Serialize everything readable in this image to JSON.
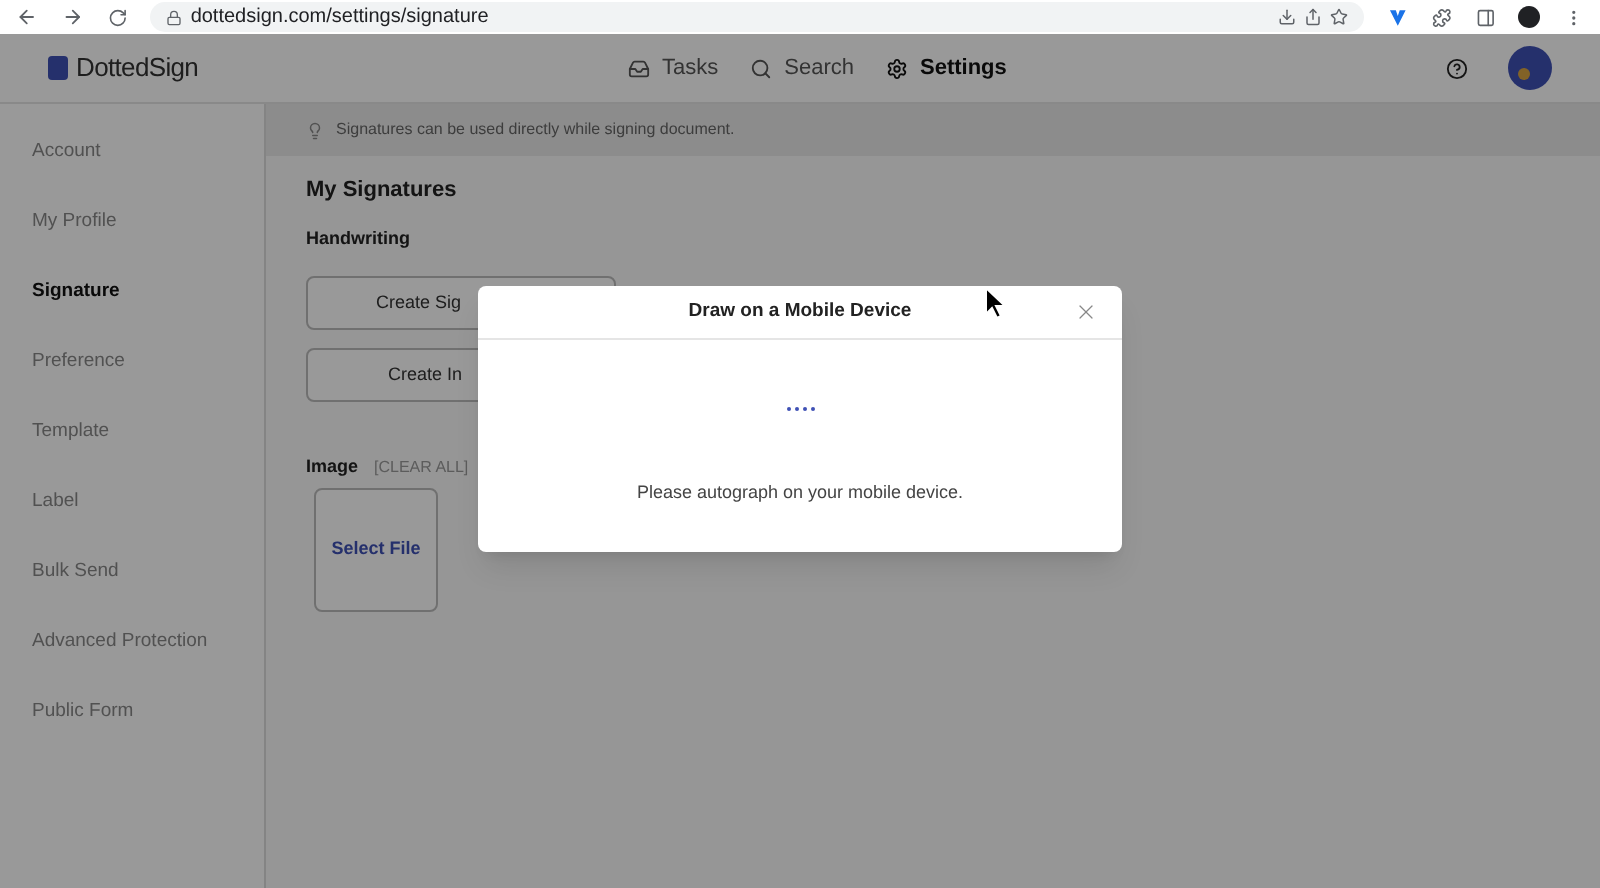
{
  "browser": {
    "url": "dottedsign.com/settings/signature"
  },
  "header": {
    "logo": "DottedSign",
    "nav": [
      {
        "label": "Tasks",
        "kind": "tasks",
        "selected": false
      },
      {
        "label": "Search",
        "kind": "search",
        "selected": false
      },
      {
        "label": "Settings",
        "kind": "settings",
        "selected": true
      }
    ]
  },
  "sidebar": {
    "items": [
      {
        "label": "Account",
        "selected": false
      },
      {
        "label": "My Profile",
        "selected": false
      },
      {
        "label": "Signature",
        "selected": true
      },
      {
        "label": "Preference",
        "selected": false
      },
      {
        "label": "Template",
        "selected": false
      },
      {
        "label": "Label",
        "selected": false
      },
      {
        "label": "Bulk Send",
        "selected": false
      },
      {
        "label": "Advanced Protection",
        "selected": false
      },
      {
        "label": "Public Form",
        "selected": false
      }
    ]
  },
  "tip": "Signatures can be used directly while signing document.",
  "content": {
    "title": "My Signatures",
    "handwriting_label": "Handwriting",
    "buttons": [
      "Create Sig",
      "Create In"
    ],
    "image_label": "Image",
    "clear_all": "[CLEAR ALL]",
    "select_file": "Select File"
  },
  "dialog": {
    "title": "Draw on a Mobile Device",
    "message": "Please autograph on your mobile device."
  }
}
